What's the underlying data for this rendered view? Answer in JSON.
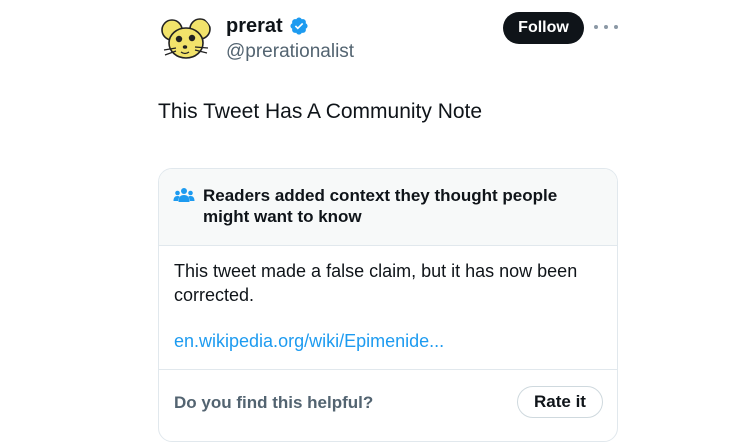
{
  "colors": {
    "accent": "#1d9bf0",
    "text_primary": "#0f1419",
    "text_secondary": "#536471",
    "border": "#e1e8ed",
    "note_header_bg": "#f7f9f9",
    "follow_bg": "#0f1419"
  },
  "author": {
    "avatar_icon": "mouse-cartoon-avatar",
    "display_name": "prerat",
    "verified_icon": "verified-badge-icon",
    "handle": "@prerationalist"
  },
  "actions": {
    "follow_label": "Follow",
    "more_icon": "more-options-icon"
  },
  "tweet": {
    "text": "This Tweet Has A Community Note"
  },
  "community_note": {
    "icon": "people-group-icon",
    "title": "Readers added context they thought people might want to know",
    "body": "This tweet made a false claim, but it has now been corrected.",
    "link_text": "en.wikipedia.org/wiki/Epimenide...",
    "helpful_question": "Do you find this helpful?",
    "rate_label": "Rate it"
  }
}
